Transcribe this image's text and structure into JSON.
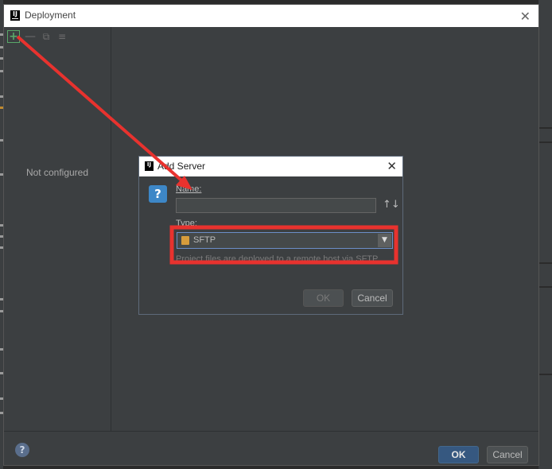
{
  "main_window": {
    "title": "Deployment",
    "toolbar": {
      "add_icon": "+",
      "remove_icon": "—",
      "copy_icon": "⧉",
      "move_icon": "≡"
    },
    "left_panel": {
      "empty_text": "Not configured"
    },
    "footer": {
      "help_icon": "?",
      "ok_label": "OK",
      "cancel_label": "Cancel"
    }
  },
  "add_server_dialog": {
    "title": "Add Server",
    "help_icon": "?",
    "name_label": "Name:",
    "name_value": "",
    "sort_icon": "↑↓",
    "type_label": "Type:",
    "type_value": "SFTP",
    "description": "Project files are deployed to a remote host via SFTP",
    "ok_label": "OK",
    "cancel_label": "Cancel"
  },
  "colors": {
    "annotation": "#e8322e",
    "background": "#3c3f41",
    "accent": "#365880"
  }
}
